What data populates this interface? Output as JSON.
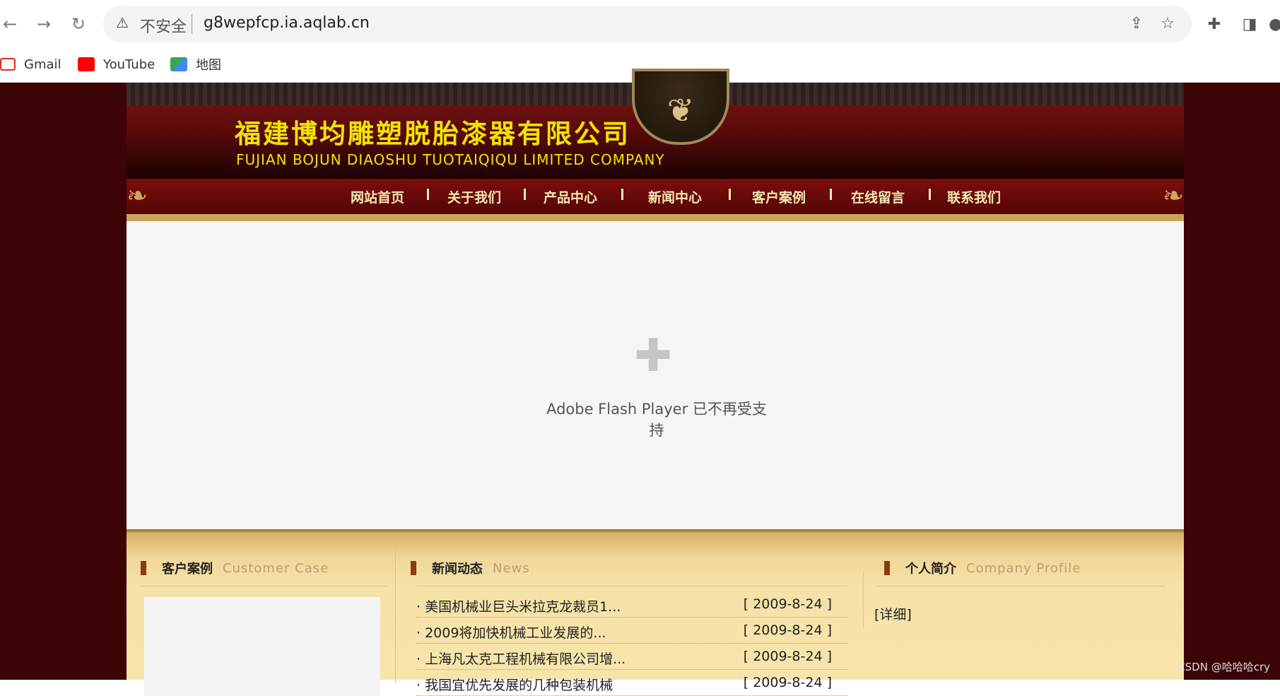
{
  "browser": {
    "security_label": "不安全",
    "url": "g8wepfcp.ia.aqlab.cn",
    "bookmarks": [
      {
        "label": "Gmail",
        "icon": "gmail-icon"
      },
      {
        "label": "YouTube",
        "icon": "youtube-icon"
      },
      {
        "label": "地图",
        "icon": "maps-icon"
      }
    ]
  },
  "site": {
    "company_cn": "福建博均雕塑脱胎漆器有限公司",
    "company_en": "FUJIAN BOJUN DIAOSHU  TUOTAIQIQU  LIMITED COMPANY",
    "emblem_text": "",
    "nav": [
      "网站首页",
      "关于我们",
      "产品中心",
      "新闻中心",
      "客户案例",
      "在线留言",
      "联系我们"
    ],
    "flash_message": "Adobe Flash Player 已不再受支持",
    "panels": {
      "cases": {
        "cn": "客户案例",
        "en": "Customer Case"
      },
      "news": {
        "cn": "新闻动态",
        "en": "News"
      },
      "profile": {
        "cn": "个人简介",
        "en": "Company Profile",
        "detail": "[详细]"
      }
    },
    "news_items": [
      {
        "title": "· 美国机械业巨头米拉克龙裁员1...",
        "date": "[ 2009-8-24 ]"
      },
      {
        "title": "· 2009将加快机械工业发展的...",
        "date": "[ 2009-8-24 ]"
      },
      {
        "title": "· 上海凡太克工程机械有限公司增...",
        "date": "[ 2009-8-24 ]"
      },
      {
        "title": "· 我国宜优先发展的几种包装机械",
        "date": "[ 2009-8-24 ]"
      }
    ]
  },
  "watermark": "CSDN @哈哈哈cry",
  "colors": {
    "page_bg": "#3c0406",
    "nav_text": "#f5e9b0",
    "company_text": "#f2e300",
    "panel_bg": "#f6e4ab"
  }
}
